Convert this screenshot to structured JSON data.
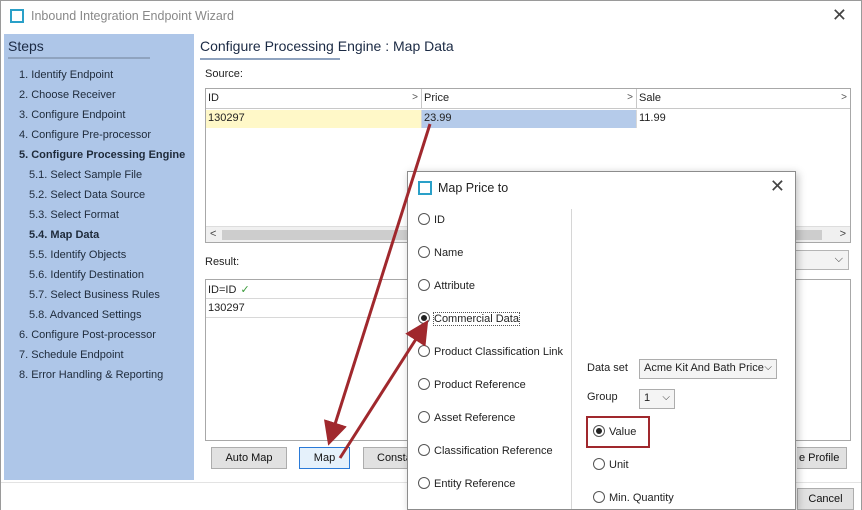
{
  "window": {
    "title": "Inbound Integration Endpoint Wizard",
    "close_glyph": "✕"
  },
  "steps": {
    "header": "Steps",
    "items": [
      {
        "label": "1. Identify Endpoint"
      },
      {
        "label": "2. Choose Receiver"
      },
      {
        "label": "3. Configure Endpoint"
      },
      {
        "label": "4. Configure Pre-processor"
      },
      {
        "label": "5. Configure Processing Engine"
      },
      {
        "label": "5.1. Select Sample File"
      },
      {
        "label": "5.2. Select Data Source"
      },
      {
        "label": "5.3. Select Format"
      },
      {
        "label": "5.4. Map Data"
      },
      {
        "label": "5.5. Identify Objects"
      },
      {
        "label": "5.6. Identify Destination"
      },
      {
        "label": "5.7. Select Business Rules"
      },
      {
        "label": "5.8. Advanced Settings"
      },
      {
        "label": "6. Configure Post-processor"
      },
      {
        "label": "7. Schedule Endpoint"
      },
      {
        "label": "8. Error Handling & Reporting"
      }
    ]
  },
  "page": {
    "title": "Configure Processing Engine : Map Data"
  },
  "source": {
    "label": "Source:",
    "columns": [
      "ID",
      "Price",
      "Sale"
    ],
    "row": [
      "130297",
      "23.99",
      "11.99"
    ],
    "scroll_left": "<",
    "scroll_right": ">"
  },
  "result": {
    "label": "Result:",
    "rows": [
      "ID=ID",
      "130297"
    ]
  },
  "buttons": {
    "auto_map": "Auto Map",
    "map": "Map",
    "constant": "Consta",
    "save_profile": "e Profile",
    "cancel": "Cancel"
  },
  "dialog": {
    "title": "Map Price to",
    "options": [
      {
        "label": "ID",
        "selected": false
      },
      {
        "label": "Name",
        "selected": false
      },
      {
        "label": "Attribute",
        "selected": false
      },
      {
        "label": "Commercial Data",
        "selected": true
      },
      {
        "label": "Product Classification Link",
        "selected": false
      },
      {
        "label": "Product Reference",
        "selected": false
      },
      {
        "label": "Asset Reference",
        "selected": false
      },
      {
        "label": "Classification Reference",
        "selected": false
      },
      {
        "label": "Entity Reference",
        "selected": false
      }
    ],
    "dataset_label": "Data set",
    "dataset_value": "Acme Kit And Bath Price",
    "group_label": "Group",
    "group_value": "1",
    "value_options": [
      {
        "label": "Value",
        "selected": true
      },
      {
        "label": "Unit",
        "selected": false
      },
      {
        "label": "Min. Quantity",
        "selected": false
      }
    ]
  },
  "colors": {
    "steps_bg": "#aec6e8",
    "id_cell_bg": "#fff8c8",
    "price_cell_bg": "#b5cbea",
    "annotation": "#a0282d"
  }
}
